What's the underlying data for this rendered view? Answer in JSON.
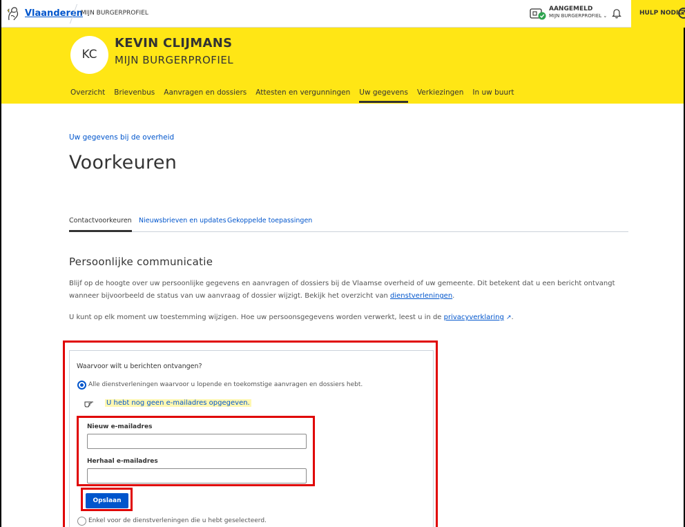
{
  "topbar": {
    "brand": "Vlaanderen",
    "crumb": "MIJN BURGERPROFIEL",
    "status_title": "AANGEMELD",
    "status_sub": "MIJN BURGERPROFIEL",
    "help": "HULP NODIG"
  },
  "header": {
    "initials": "KC",
    "name": "KEVIN CLIJMANS",
    "subtitle": "MIJN BURGERPROFIEL",
    "nav": [
      {
        "label": "Overzicht"
      },
      {
        "label": "Brievenbus"
      },
      {
        "label": "Aanvragen en dossiers"
      },
      {
        "label": "Attesten en vergunningen"
      },
      {
        "label": "Uw gegevens"
      },
      {
        "label": "Verkiezingen"
      },
      {
        "label": "In uw buurt"
      }
    ],
    "active_nav": "Uw gegevens"
  },
  "main": {
    "kicker": "Uw gegevens bij de overheid",
    "title": "Voorkeuren",
    "tabs": [
      {
        "label": "Contactvoorkeuren"
      },
      {
        "label": "Nieuwsbrieven en updates"
      },
      {
        "label": "Gekoppelde toepassingen"
      }
    ],
    "section_title": "Persoonlijke communicatie",
    "para1_a": "Blijf op de hoogte over uw persoonlijke gegevens en aanvragen of dossiers bij de Vlaamse overheid of uw gemeente. Dit betekent dat u een bericht ontvangt wanneer bijvoorbeeld de status van uw aanvraag of dossier wijzigt. Bekijk het overzicht van ",
    "para1_link": "dienstverleningen",
    "para1_b": ".",
    "para2_a": "U kunt op elk moment uw toestemming wijzigen. Hoe uw persoonsgegevens worden verwerkt, leest u in de ",
    "para2_link": "privacyverklaring",
    "para2_b": "."
  },
  "form": {
    "question": "Waarvoor wilt u berichten ontvangen?",
    "option_all": "Alle dienstverleningen waarvoor u lopende en toekomstige aanvragen en dossiers hebt.",
    "notice": "U hebt nog geen e-mailadres opgegeven.",
    "email_label": "Nieuw e-mailadres",
    "email_value": "",
    "repeat_label": "Herhaal e-mailadres",
    "repeat_value": "",
    "save": "Opslaan",
    "option_selected": "Enkel voor de dienstverleningen die u hebt geselecteerd."
  },
  "colors": {
    "brand_yellow": "#ffe615",
    "link_blue": "#0055cc",
    "highlight_red": "#e00000"
  }
}
